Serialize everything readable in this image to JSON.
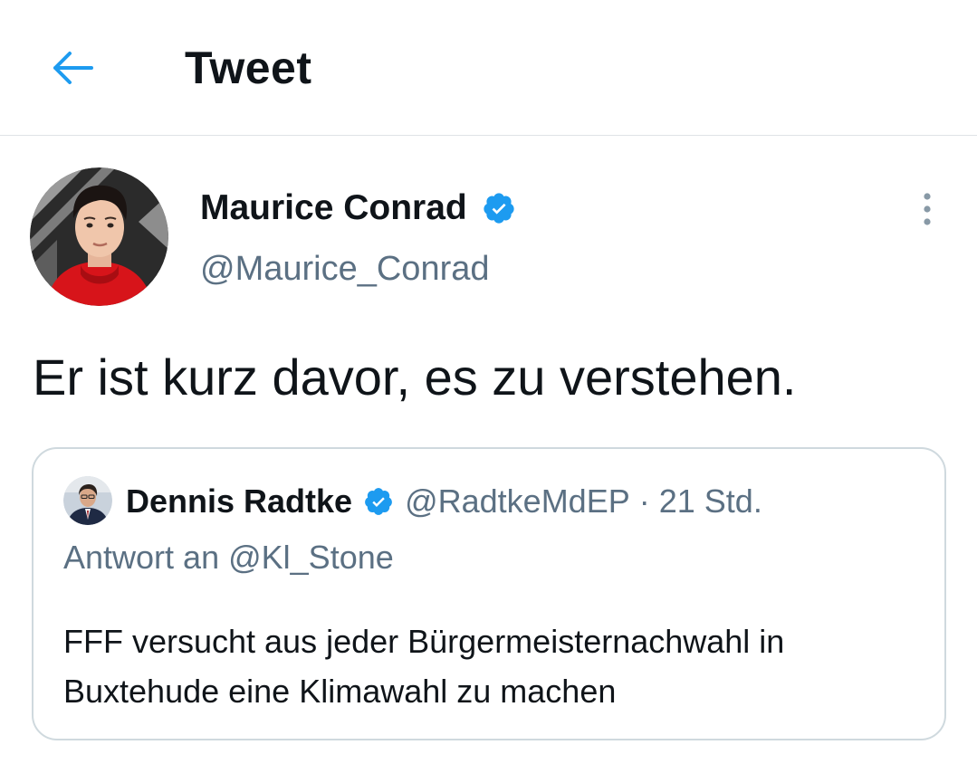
{
  "header": {
    "back_icon": "arrow-left-icon",
    "title": "Tweet"
  },
  "tweet": {
    "author": {
      "name": "Maurice Conrad",
      "handle": "@Maurice_Conrad",
      "verified": true,
      "avatar_icon": "avatar"
    },
    "more_icon": "more-vertical-icon",
    "text": "Er ist kurz davor, es zu verstehen.",
    "quote": {
      "author": {
        "name": "Dennis Radtke",
        "handle": "@RadtkeMdEP",
        "verified": true
      },
      "separator": "·",
      "time": "21 Std.",
      "reply_prefix": "Antwort an",
      "reply_handle": "@Kl_Stone",
      "text": "FFF versucht aus jeder Bürgermeisternachwahl in Buxtehude eine Klimawahl zu machen"
    }
  },
  "colors": {
    "accent": "#1d9bf0",
    "text_primary": "#0f1419",
    "text_secondary": "#5b7083",
    "border": "#cfd9de"
  }
}
